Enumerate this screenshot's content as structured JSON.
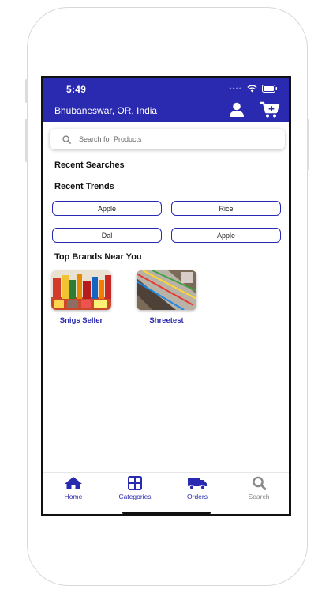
{
  "status_bar": {
    "time": "5:49",
    "signal_dots": "••••"
  },
  "header": {
    "location": "Bhubaneswar, OR, India",
    "profile_icon": "user-icon",
    "cart_icon": "cart-add-icon"
  },
  "search": {
    "placeholder": "Search for Products",
    "value": "",
    "icon": "search-icon"
  },
  "recent_searches": {
    "title": "Recent Searches"
  },
  "recent_trends": {
    "title": "Recent Trends",
    "items": [
      "Apple",
      "Rice",
      "Dal",
      "Apple"
    ]
  },
  "top_brands": {
    "title": "Top Brands Near You",
    "items": [
      {
        "name": "Snigs Seller"
      },
      {
        "name": "Shreetest"
      }
    ]
  },
  "nav": {
    "items": [
      {
        "label": "Home",
        "icon": "home-icon",
        "active": true
      },
      {
        "label": "Categories",
        "icon": "grid-icon",
        "active": true
      },
      {
        "label": "Orders",
        "icon": "truck-icon",
        "active": true
      },
      {
        "label": "Search",
        "icon": "search-icon",
        "active": false
      }
    ]
  },
  "colors": {
    "primary": "#2a2ab0",
    "inactive": "#888888",
    "background": "#ffffff"
  }
}
